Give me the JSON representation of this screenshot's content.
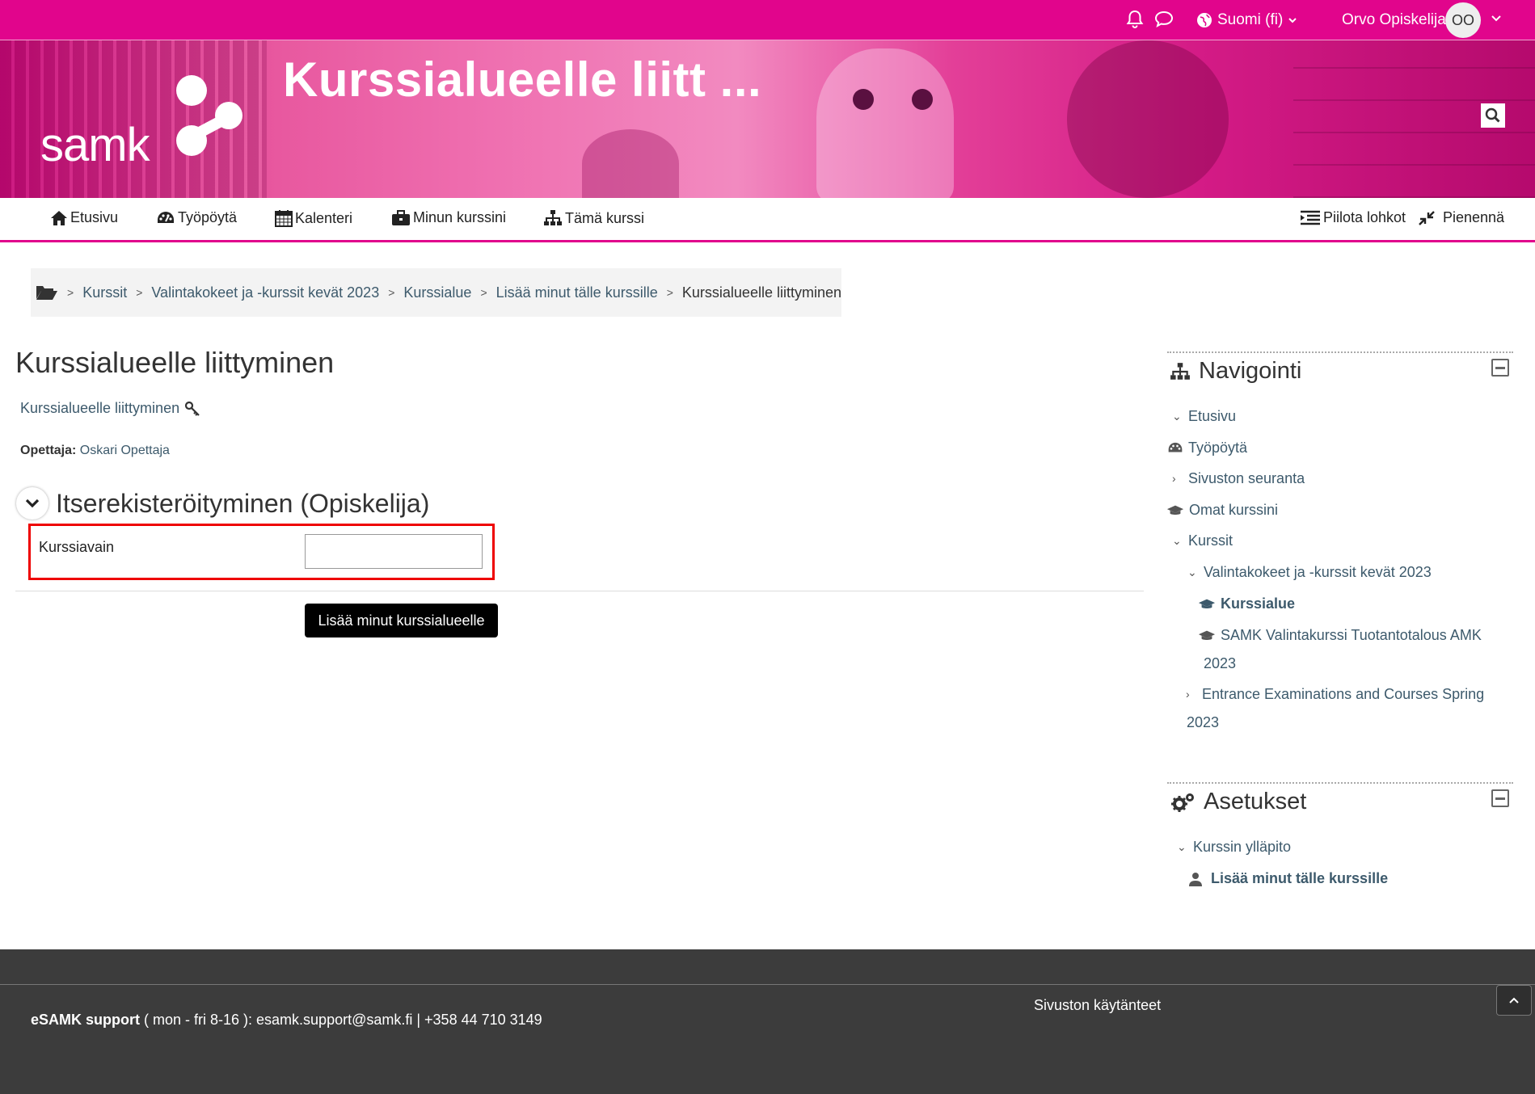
{
  "topbar": {
    "language": "Suomi (fi)",
    "user_name": "Orvo Opiskelija",
    "user_initials": "OO"
  },
  "banner": {
    "title": "Kurssialueelle liitt ...",
    "logo_text": "samk"
  },
  "nav": {
    "home": "Etusivu",
    "dashboard": "Työpöytä",
    "calendar": "Kalenteri",
    "my_courses": "Minun kurssini",
    "this_course": "Tämä kurssi",
    "hide_blocks": "Piilota lohkot",
    "minimize": "Pienennä"
  },
  "breadcrumb": [
    "Kurssit",
    "Valintakokeet ja -kurssit kevät 2023",
    "Kurssialue",
    "Lisää minut tälle kurssille",
    "Kurssialueelle liittyminen"
  ],
  "main": {
    "title": "Kurssialueelle liittyminen",
    "enrol_link": "Kurssialueelle liittyminen",
    "teacher_label": "Opettaja:",
    "teacher_name": "Oskari Opettaja",
    "section_title": "Itserekisteröityminen (Opiskelija)",
    "key_label": "Kurssiavain",
    "key_value": "",
    "submit_label": "Lisää minut kurssialueelle"
  },
  "navigation_block": {
    "title": "Navigointi",
    "items": {
      "home": "Etusivu",
      "dashboard": "Työpöytä",
      "site_tracking": "Sivuston seuranta",
      "my_courses": "Omat kurssini",
      "courses": "Kurssit",
      "category": "Valintakokeet ja -kurssit kevät 2023",
      "course_area": "Kurssialue",
      "samk_course_line1": "SAMK Valintakurssi Tuotantotalous AMK",
      "samk_course_line2": "2023",
      "entrance_line1": "Entrance Examinations and Courses Spring",
      "entrance_line2": "2023"
    }
  },
  "settings_block": {
    "title": "Asetukset",
    "course_admin": "Kurssin ylläpito",
    "enrol_me": "Lisää minut tälle kurssille"
  },
  "footer": {
    "support_bold": "eSAMK support",
    "support_text": " ( mon - fri 8-16 ): esamk.support@samk.fi | +358 44 710 3149",
    "policies": "Sivuston käytänteet"
  },
  "colors": {
    "brand": "#e1058c",
    "link": "#3d5a6c",
    "footer": "#3c3c3c",
    "highlight": "#ee0000"
  }
}
